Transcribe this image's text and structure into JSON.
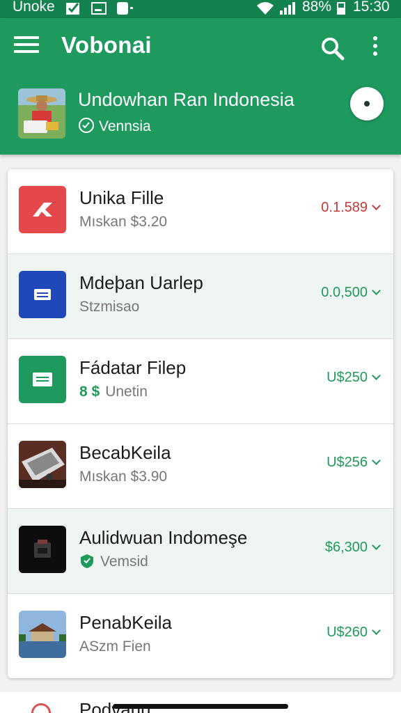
{
  "status_bar": {
    "carrier": "Unoke",
    "battery": "88%",
    "time": "15:30",
    "icons": [
      "checkbox-icon",
      "card-icon",
      "tag-icon",
      "wifi-icon",
      "signal-icon",
      "battery-icon"
    ]
  },
  "app_bar": {
    "title": "Vobonai",
    "menu_icon": "hamburger-menu-icon",
    "search_icon": "search-icon",
    "more_icon": "more-vert-icon",
    "colors": {
      "primary": "#1f9a5f",
      "status": "#14824f"
    }
  },
  "profile": {
    "name": "Undowhan Ran Indonesia",
    "subtitle": "Vennsia",
    "badge_icon": "verified-icon"
  },
  "items": [
    {
      "title": "Unika Fille",
      "subtitle": "Mıskan $3.20",
      "amount": "0.1.589",
      "icon": "red-arrow-icon",
      "amount_color": "#c43a3a"
    },
    {
      "title": "Mdeþan Uarlep",
      "subtitle": "Stzmisao",
      "amount": "0.0,500",
      "icon": "blue-document-icon"
    },
    {
      "title": "Fádatar Filep",
      "subtitle_prefix": "8 $",
      "subtitle": "Unetin",
      "amount": "U$250",
      "icon": "green-document-icon"
    },
    {
      "title": "BecabKeila",
      "subtitle": "Mıskan $3.90",
      "amount": "U$256",
      "icon": "keyboard-photo-icon"
    },
    {
      "title": "Aulidwuan Indomeşe",
      "subtitle": "Vemsid",
      "amount": "$6,300",
      "icon": "dark-app-icon"
    },
    {
      "title": "PenabKeila",
      "subtitle": "ASzm Fien",
      "amount": "U$260",
      "icon": "house-photo-icon"
    }
  ],
  "partial_item": {
    "title": "Podvauu"
  }
}
